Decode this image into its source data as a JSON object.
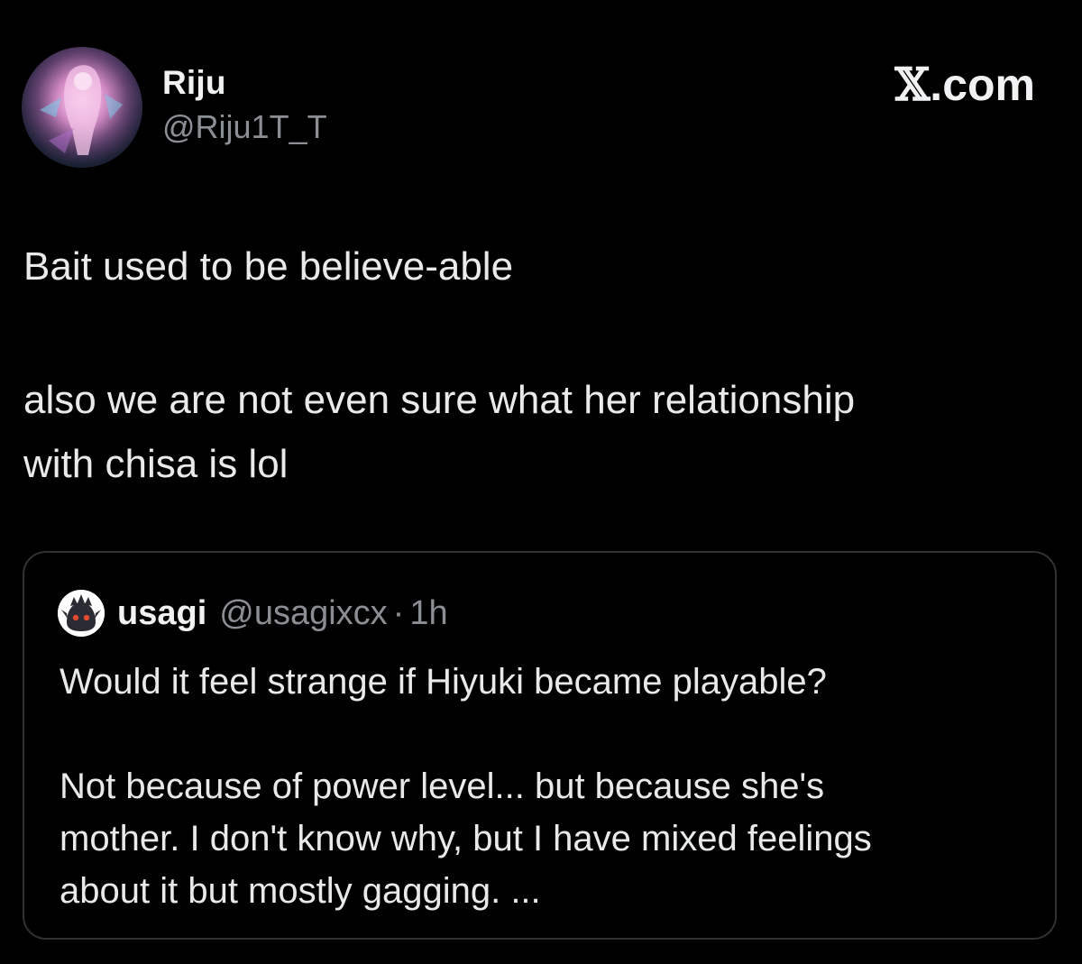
{
  "author": {
    "display_name": "Riju",
    "handle": "@Riju1T_T",
    "avatar_icon": "anime-avatar-icon"
  },
  "brand": {
    "mark": "𝕏",
    "suffix": ".com"
  },
  "tweet": {
    "paragraph_1": "Bait used to be believe-able",
    "paragraph_2_line_1": "also we are not even sure what her relationship",
    "paragraph_2_line_2": "with chisa is lol"
  },
  "quoted_tweet": {
    "display_name": "usagi",
    "handle": "@usagixcx",
    "separator": "·",
    "time": "1h",
    "avatar_icon": "spiky-creature-avatar-icon",
    "line_1": "Would it feel strange if Hiyuki became playable?",
    "line_2": "Not because of power level... but because she's",
    "line_3": "mother. I don't know why, but I have mixed feelings",
    "line_4": "about it but mostly gagging. ..."
  },
  "colors": {
    "background": "#000000",
    "primary_text": "#e7e9ea",
    "secondary_text": "#8b8f94",
    "border": "#2f3336"
  }
}
